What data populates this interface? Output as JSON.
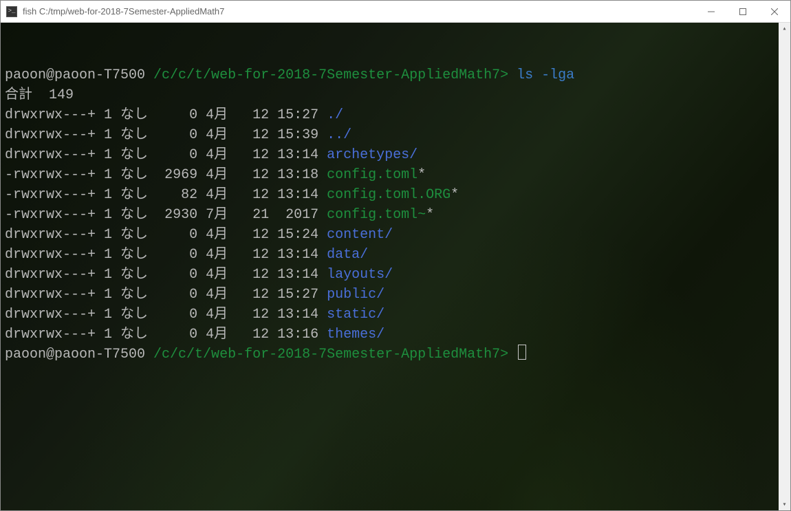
{
  "title": "fish  C:/tmp/web-for-2018-7Semester-AppliedMath7",
  "icon_glyph": ">_",
  "prompt": {
    "userhost": "paoon@paoon-T7500 ",
    "path": "/c/c/t/web-for-2018-7Semester-AppliedMath7",
    "sep": "> "
  },
  "command": "ls -lga",
  "total_line": "合計  149",
  "listing": [
    {
      "perm": "drwxrwx---+ ",
      "links": "1 ",
      "owner": "なし ",
      "size": "    0 ",
      "month": "4月  ",
      "day": " 12 ",
      "time": "15:27 ",
      "name": "./",
      "kind": "dir",
      "suffix": ""
    },
    {
      "perm": "drwxrwx---+ ",
      "links": "1 ",
      "owner": "なし ",
      "size": "    0 ",
      "month": "4月  ",
      "day": " 12 ",
      "time": "15:39 ",
      "name": "../",
      "kind": "dir",
      "suffix": ""
    },
    {
      "perm": "drwxrwx---+ ",
      "links": "1 ",
      "owner": "なし ",
      "size": "    0 ",
      "month": "4月  ",
      "day": " 12 ",
      "time": "13:14 ",
      "name": "archetypes/",
      "kind": "dir",
      "suffix": ""
    },
    {
      "perm": "-rwxrwx---+ ",
      "links": "1 ",
      "owner": "なし ",
      "size": " 2969 ",
      "month": "4月  ",
      "day": " 12 ",
      "time": "13:18 ",
      "name": "config.toml",
      "kind": "exec",
      "suffix": "*"
    },
    {
      "perm": "-rwxrwx---+ ",
      "links": "1 ",
      "owner": "なし ",
      "size": "   82 ",
      "month": "4月  ",
      "day": " 12 ",
      "time": "13:14 ",
      "name": "config.toml.ORG",
      "kind": "exec",
      "suffix": "*"
    },
    {
      "perm": "-rwxrwx---+ ",
      "links": "1 ",
      "owner": "なし ",
      "size": " 2930 ",
      "month": "7月  ",
      "day": " 21 ",
      "time": " 2017 ",
      "name": "config.toml~",
      "kind": "exec",
      "suffix": "*"
    },
    {
      "perm": "drwxrwx---+ ",
      "links": "1 ",
      "owner": "なし ",
      "size": "    0 ",
      "month": "4月  ",
      "day": " 12 ",
      "time": "15:24 ",
      "name": "content/",
      "kind": "dir",
      "suffix": ""
    },
    {
      "perm": "drwxrwx---+ ",
      "links": "1 ",
      "owner": "なし ",
      "size": "    0 ",
      "month": "4月  ",
      "day": " 12 ",
      "time": "13:14 ",
      "name": "data/",
      "kind": "dir",
      "suffix": ""
    },
    {
      "perm": "drwxrwx---+ ",
      "links": "1 ",
      "owner": "なし ",
      "size": "    0 ",
      "month": "4月  ",
      "day": " 12 ",
      "time": "13:14 ",
      "name": "layouts/",
      "kind": "dir",
      "suffix": ""
    },
    {
      "perm": "drwxrwx---+ ",
      "links": "1 ",
      "owner": "なし ",
      "size": "    0 ",
      "month": "4月  ",
      "day": " 12 ",
      "time": "15:27 ",
      "name": "public/",
      "kind": "dir",
      "suffix": ""
    },
    {
      "perm": "drwxrwx---+ ",
      "links": "1 ",
      "owner": "なし ",
      "size": "    0 ",
      "month": "4月  ",
      "day": " 12 ",
      "time": "13:14 ",
      "name": "static/",
      "kind": "dir",
      "suffix": ""
    },
    {
      "perm": "drwxrwx---+ ",
      "links": "1 ",
      "owner": "なし ",
      "size": "    0 ",
      "month": "4月  ",
      "day": " 12 ",
      "time": "13:16 ",
      "name": "themes/",
      "kind": "dir",
      "suffix": ""
    }
  ]
}
